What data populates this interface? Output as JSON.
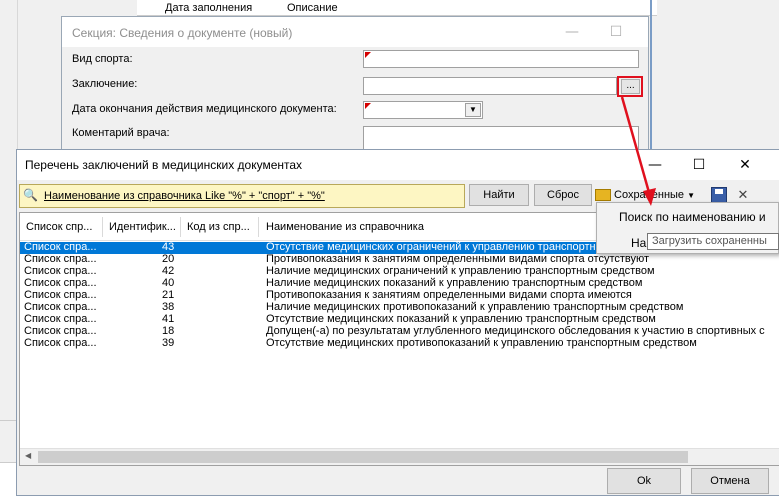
{
  "section_dialog": {
    "title": "Секция: Сведения о документе (новый)",
    "fields": {
      "sport_label": "Вид спорта:",
      "conclusion_label": "Заключение:",
      "end_date_label": "Дата окончания действия медицинского документа:",
      "doctor_comment_label": "Коментарий врача:"
    },
    "ellipsis_label": "..."
  },
  "main_dialog": {
    "title": "Перечень заключений в медицинских документах",
    "filter_text": "Наименование из справочника Like \"%\" + \"спорт\" + \"%\"",
    "find_button": "Найти",
    "reset_button": "Сброс",
    "saved_button": "Сохраненные",
    "ok_button": "Ok",
    "cancel_button": "Отмена",
    "columns": [
      "Список спр...",
      "Идентифик...",
      "Код из спр...",
      "Наименование из справочника"
    ],
    "rows": [
      {
        "list": "Список спра...",
        "id": "43",
        "code": "",
        "name": "Отсутствие медицинских ограничений к управлению транспортны"
      },
      {
        "list": "Список спра...",
        "id": "20",
        "code": "",
        "name": "Противопоказания к занятиям определенными видами спорта отсутствуют"
      },
      {
        "list": "Список спра...",
        "id": "42",
        "code": "",
        "name": "Наличие медицинских ограничений к управлению транспортным средством"
      },
      {
        "list": "Список спра...",
        "id": "40",
        "code": "",
        "name": "Наличие медицинских показаний к управлению транспортным средством"
      },
      {
        "list": "Список спра...",
        "id": "21",
        "code": "",
        "name": "Противопоказания к занятиям определенными видами спорта имеются"
      },
      {
        "list": "Список спра...",
        "id": "38",
        "code": "",
        "name": "Наличие медицинских противопоказаний к управлению транспортным средством"
      },
      {
        "list": "Список спра...",
        "id": "41",
        "code": "",
        "name": "Отсутствие медицинских показаний к управлению транспортным средством"
      },
      {
        "list": "Список спра...",
        "id": "18",
        "code": "",
        "name": "Допущен(-а) по результатам углубленного медицинского обследования к участию в спортивных с"
      },
      {
        "list": "Список спра...",
        "id": "39",
        "code": "",
        "name": "Отсутствие медицинских противопоказаний к управлению транспортным средством"
      }
    ]
  },
  "popup_menu": {
    "items": [
      "Поиск по наименованию и",
      "На"
    ],
    "tooltip": "Загрузить сохраненны"
  },
  "background": {
    "header_cells": [
      "Дата заполнения",
      "Описание"
    ]
  },
  "colors": {
    "selection": "#0078d7",
    "filter_bg": "#fdf6c3",
    "highlight_red": "#e0101e"
  }
}
